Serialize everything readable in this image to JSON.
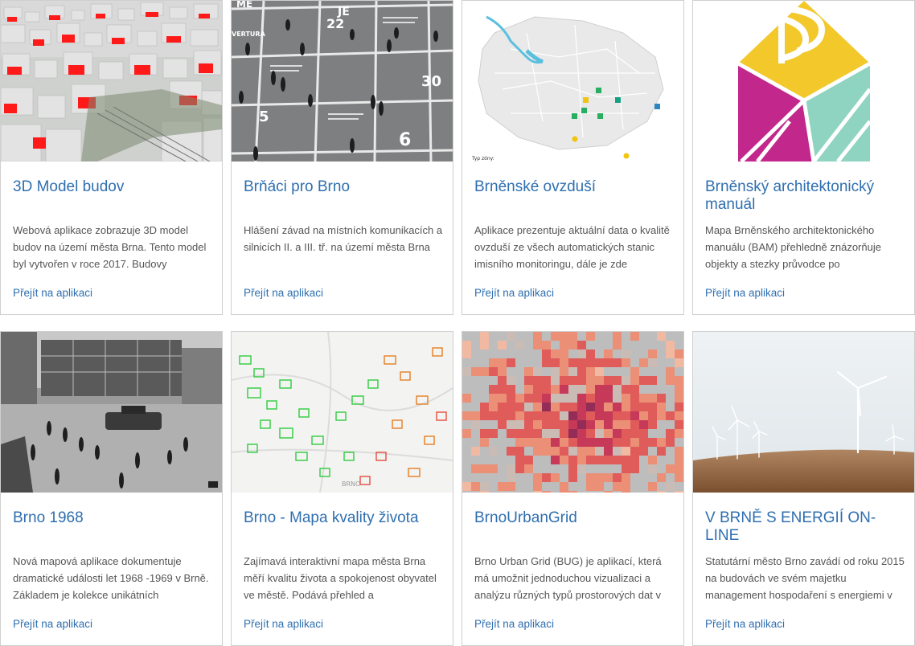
{
  "link_label": "Přejít na aplikaci",
  "accent_color": "#2f6fb0",
  "cards": [
    {
      "title": "3D Model budov",
      "description": "Webová aplikace zobrazuje 3D model budov na území města Brna. Tento model byl vytvořen v roce 2017. Budovy",
      "link": "Přejít na aplikaci"
    },
    {
      "title": "Brňáci pro Brno",
      "description": "Hlášení závad na místních komunikacích a silnicích II. a III. tř. na území města Brna",
      "link": "Přejít na aplikaci"
    },
    {
      "title": "Brněnské ovzduší",
      "description": "Aplikace prezentuje aktuální data o kvalitě ovzduší ze všech automatických stanic imisního monitoringu, dále je zde",
      "link": "Přejít na aplikaci"
    },
    {
      "title": "Brněnský architektonický manuál",
      "description": "Mapa Brněnského architektonického manuálu (BAM) přehledně znázorňuje objekty a stezky průvodce po",
      "link": "Přejít na aplikaci"
    },
    {
      "title": "Brno 1968",
      "description": "Nová mapová aplikace dokumentuje dramatické události let 1968 -1969 v Brně. Základem je kolekce unikátních",
      "link": "Přejít na aplikaci"
    },
    {
      "title": "Brno - Mapa kvality života",
      "description": "Zajímavá interaktivní mapa města Brna měří kvalitu života a spokojenost obyvatel ve městě. Podává přehled a",
      "link": "Přejít na aplikaci"
    },
    {
      "title": "BrnoUrbanGrid",
      "description": "Brno Urban Grid (BUG) je aplikací, která má umožnit jednoduchou vizualizaci a analýzu různých typů prostorových dat v",
      "link": "Přejít na aplikaci"
    },
    {
      "title": "V BRNĚ S ENERGIÍ ON-LINE",
      "description": "Statutární město Brno zavádí od roku 2015 na budovách ve svém majetku management hospodaření s energiemi v",
      "link": "Přejít na aplikaci"
    }
  ],
  "thumb_text": {
    "brnaci_words": [
      "ME",
      "JE",
      "22",
      "30",
      "5",
      "6",
      "VERTURA"
    ],
    "ovzdusi_legend": "Typ zóny:",
    "mapa_label": "BRNO"
  }
}
